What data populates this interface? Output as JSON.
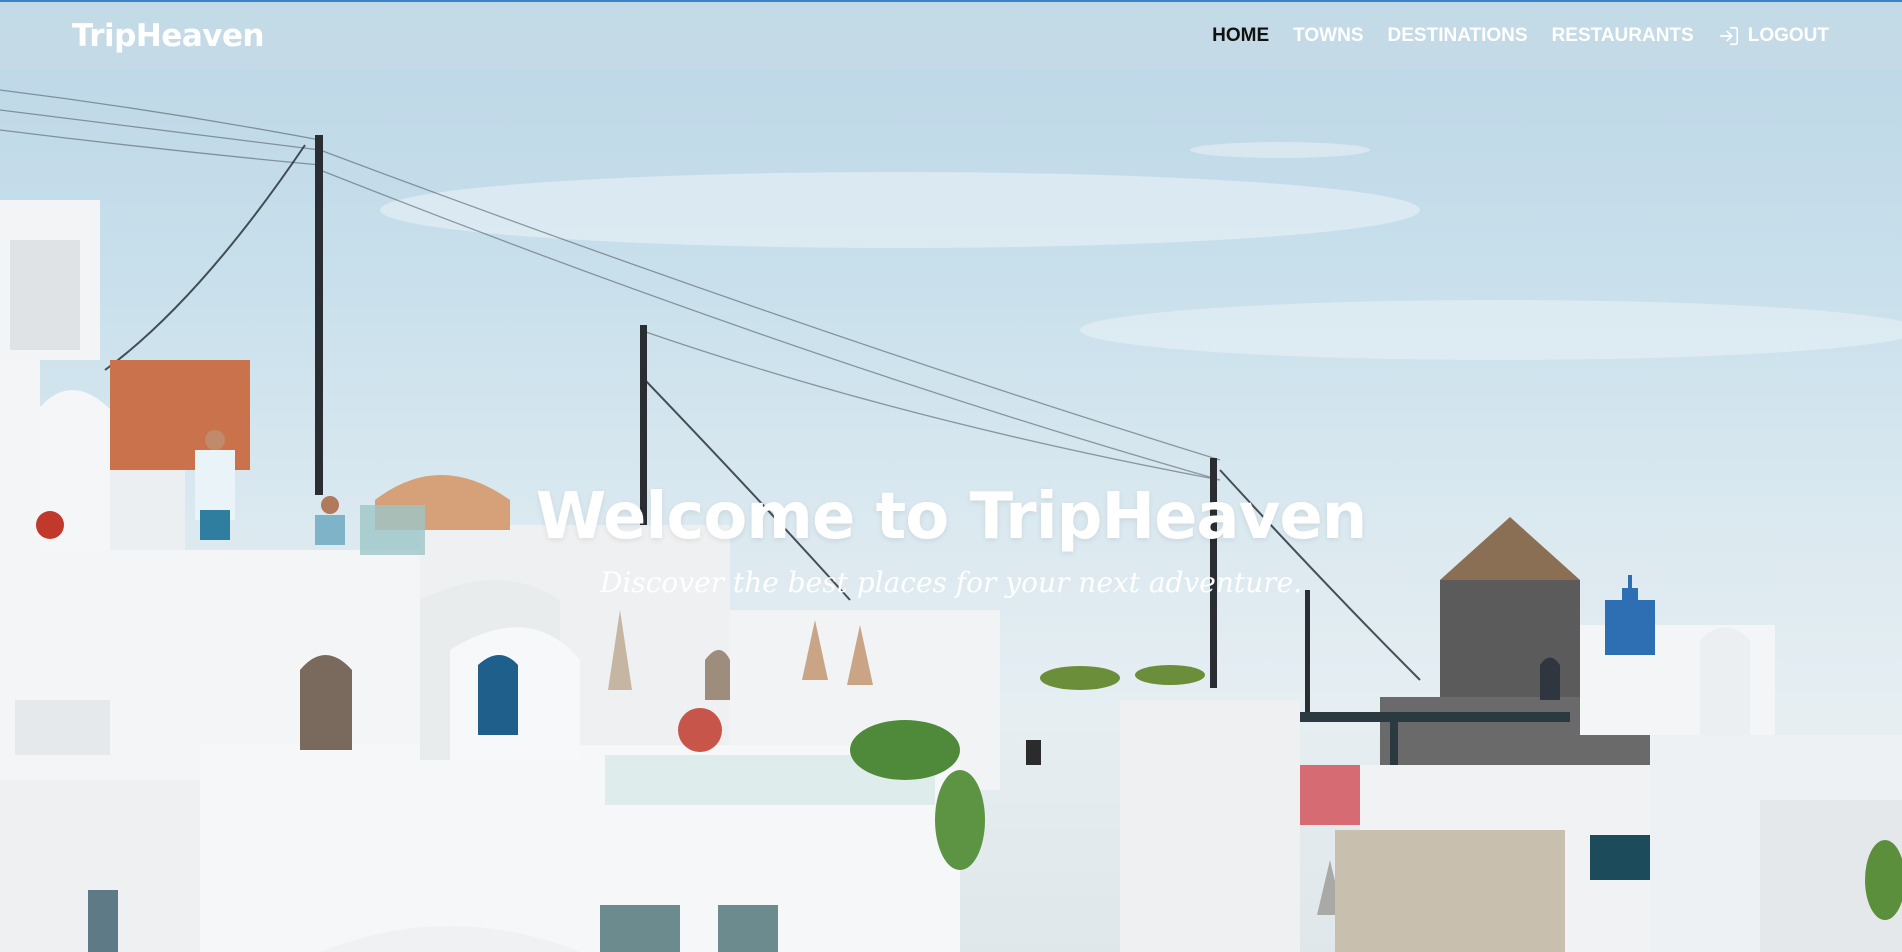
{
  "brand": {
    "name": "TripHeaven"
  },
  "nav": {
    "items": [
      {
        "label": "HOME",
        "active": true
      },
      {
        "label": "TOWNS",
        "active": false
      },
      {
        "label": "DESTINATIONS",
        "active": false
      },
      {
        "label": "RESTAURANTS",
        "active": false
      },
      {
        "label": "LOGOUT",
        "active": false,
        "icon": "logout-icon"
      }
    ]
  },
  "hero": {
    "title": "Welcome to TripHeaven",
    "subtitle": "Discover the best places for your next adventure."
  },
  "colors": {
    "accent_line": "#3b82c4",
    "nav_active": "#111111",
    "nav_text": "#ffffff"
  }
}
